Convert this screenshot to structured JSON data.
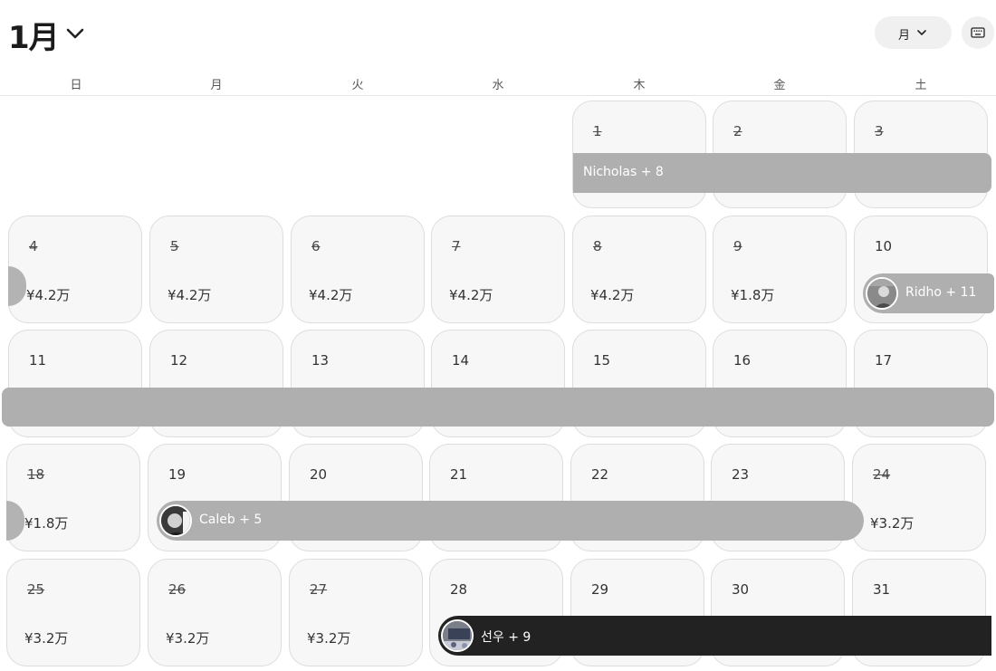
{
  "header": {
    "month_title": "1月",
    "view_select_label": "月"
  },
  "weekdays": [
    "日",
    "月",
    "火",
    "水",
    "木",
    "金",
    "土"
  ],
  "days": {
    "d1": "1",
    "d2": "2",
    "d3": "3",
    "d4": "4",
    "d5": "5",
    "d6": "6",
    "d7": "7",
    "d8": "8",
    "d9": "9",
    "d10": "10",
    "d11": "11",
    "d12": "12",
    "d13": "13",
    "d14": "14",
    "d15": "15",
    "d16": "16",
    "d17": "17",
    "d18": "18",
    "d19": "19",
    "d20": "20",
    "d21": "21",
    "d22": "22",
    "d23": "23",
    "d24": "24",
    "d25": "25",
    "d26": "26",
    "d27": "27",
    "d28": "28",
    "d29": "29",
    "d30": "30",
    "d31": "31"
  },
  "prices": {
    "d4": "¥4.2万",
    "d5": "¥4.2万",
    "d6": "¥4.2万",
    "d7": "¥4.2万",
    "d8": "¥4.2万",
    "d9": "¥1.8万",
    "d18": "¥1.8万",
    "d24": "¥3.2万",
    "d25": "¥3.2万",
    "d26": "¥3.2万",
    "d27": "¥3.2万"
  },
  "reservations": {
    "nicholas": "Nicholas + 8",
    "ridho": "Ridho + 11",
    "caleb": "Caleb + 5",
    "seonwoo": "선우 + 9"
  },
  "icons": {
    "month_chevron": "chevron-down-icon",
    "view_chevron": "chevron-down-icon",
    "keyboard": "keyboard-icon"
  },
  "colors": {
    "reservation_bar": "#afafaf",
    "reservation_bar_active": "#222222",
    "cell_bg": "#f7f7f7"
  }
}
